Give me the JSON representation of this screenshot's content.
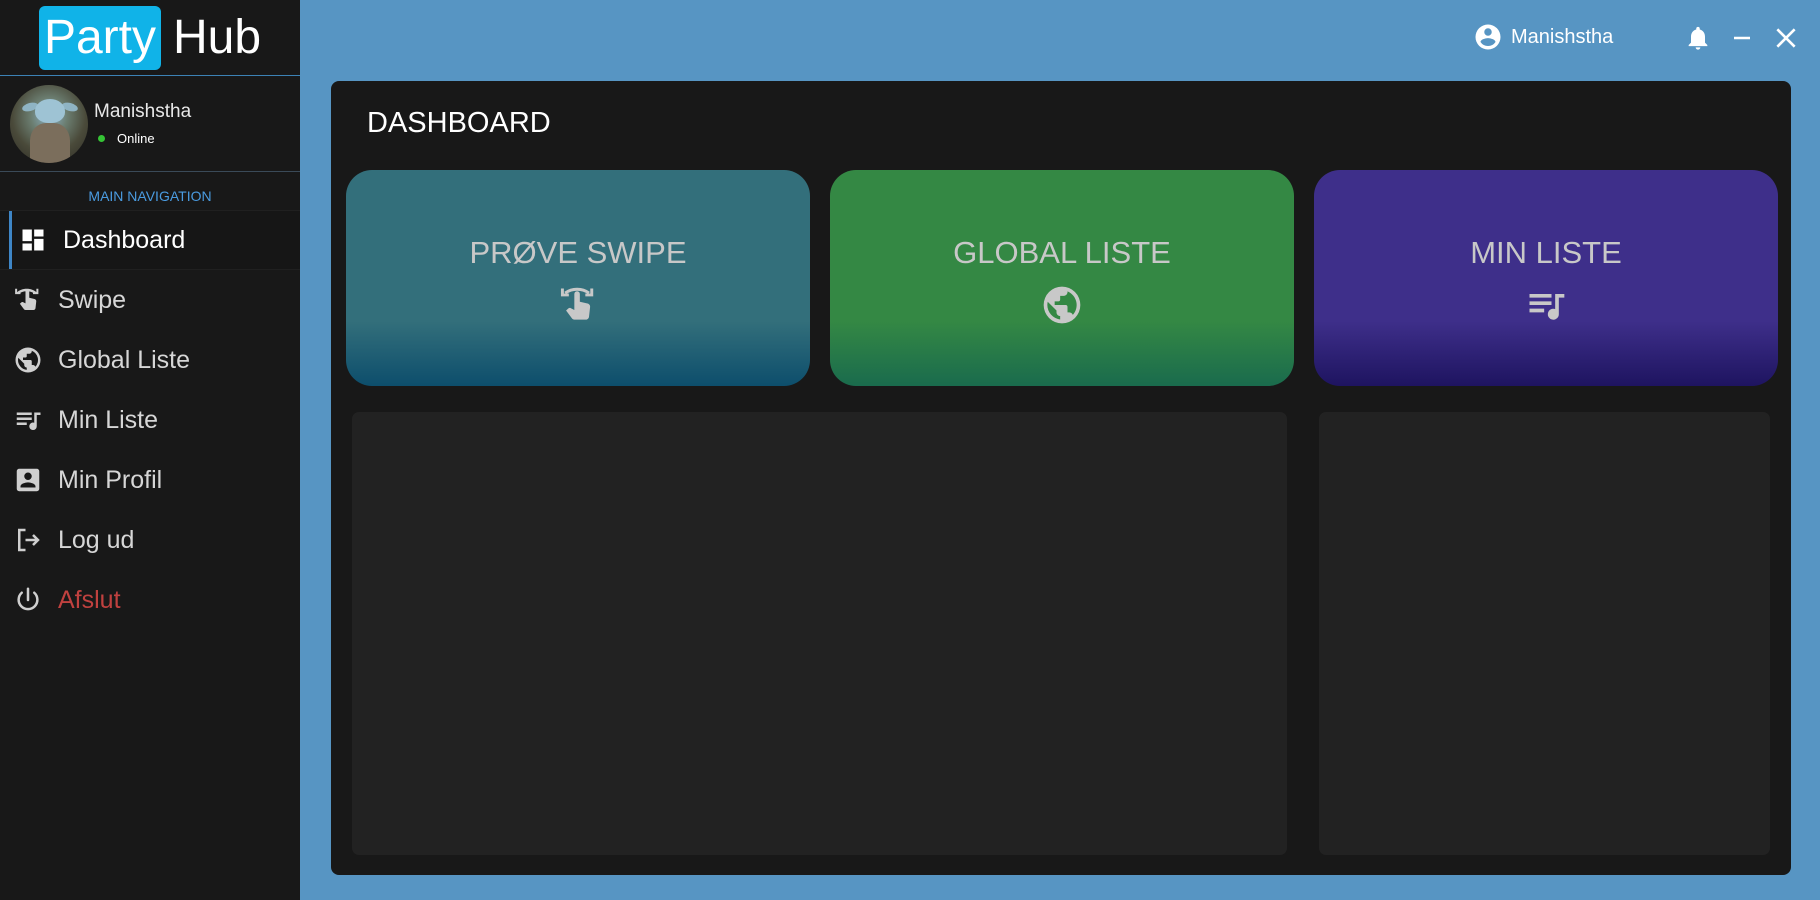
{
  "brand": {
    "part1": "Party",
    "part2": "Hub"
  },
  "profile": {
    "name": "Manishstha",
    "status": "Online"
  },
  "nav": {
    "heading": "MAIN NAVIGATION",
    "items": [
      {
        "label": "Dashboard",
        "icon": "dashboard-icon"
      },
      {
        "label": "Swipe",
        "icon": "swipe-icon"
      },
      {
        "label": "Global Liste",
        "icon": "globe-icon"
      },
      {
        "label": "Min Liste",
        "icon": "playlist-icon"
      },
      {
        "label": "Min Profil",
        "icon": "profile-card-icon"
      },
      {
        "label": "Log ud",
        "icon": "logout-icon"
      },
      {
        "label": "Afslut",
        "icon": "power-icon"
      }
    ]
  },
  "topbar": {
    "username": "Manishstha"
  },
  "page": {
    "title": "DASHBOARD"
  },
  "cards": [
    {
      "label": "PRØVE SWIPE",
      "icon": "swipe-icon",
      "color": "#336f7b"
    },
    {
      "label": "GLOBAL LISTE",
      "icon": "globe-icon",
      "color": "#348844"
    },
    {
      "label": "MIN LISTE",
      "icon": "playlist-icon",
      "color": "#3e2f8a"
    }
  ],
  "colors": {
    "background": "#5795c3",
    "sidebar": "#181818",
    "brand_accent": "#10b3e8",
    "nav_heading": "#4a9be0",
    "danger": "#c0413f",
    "online": "#35c435"
  }
}
